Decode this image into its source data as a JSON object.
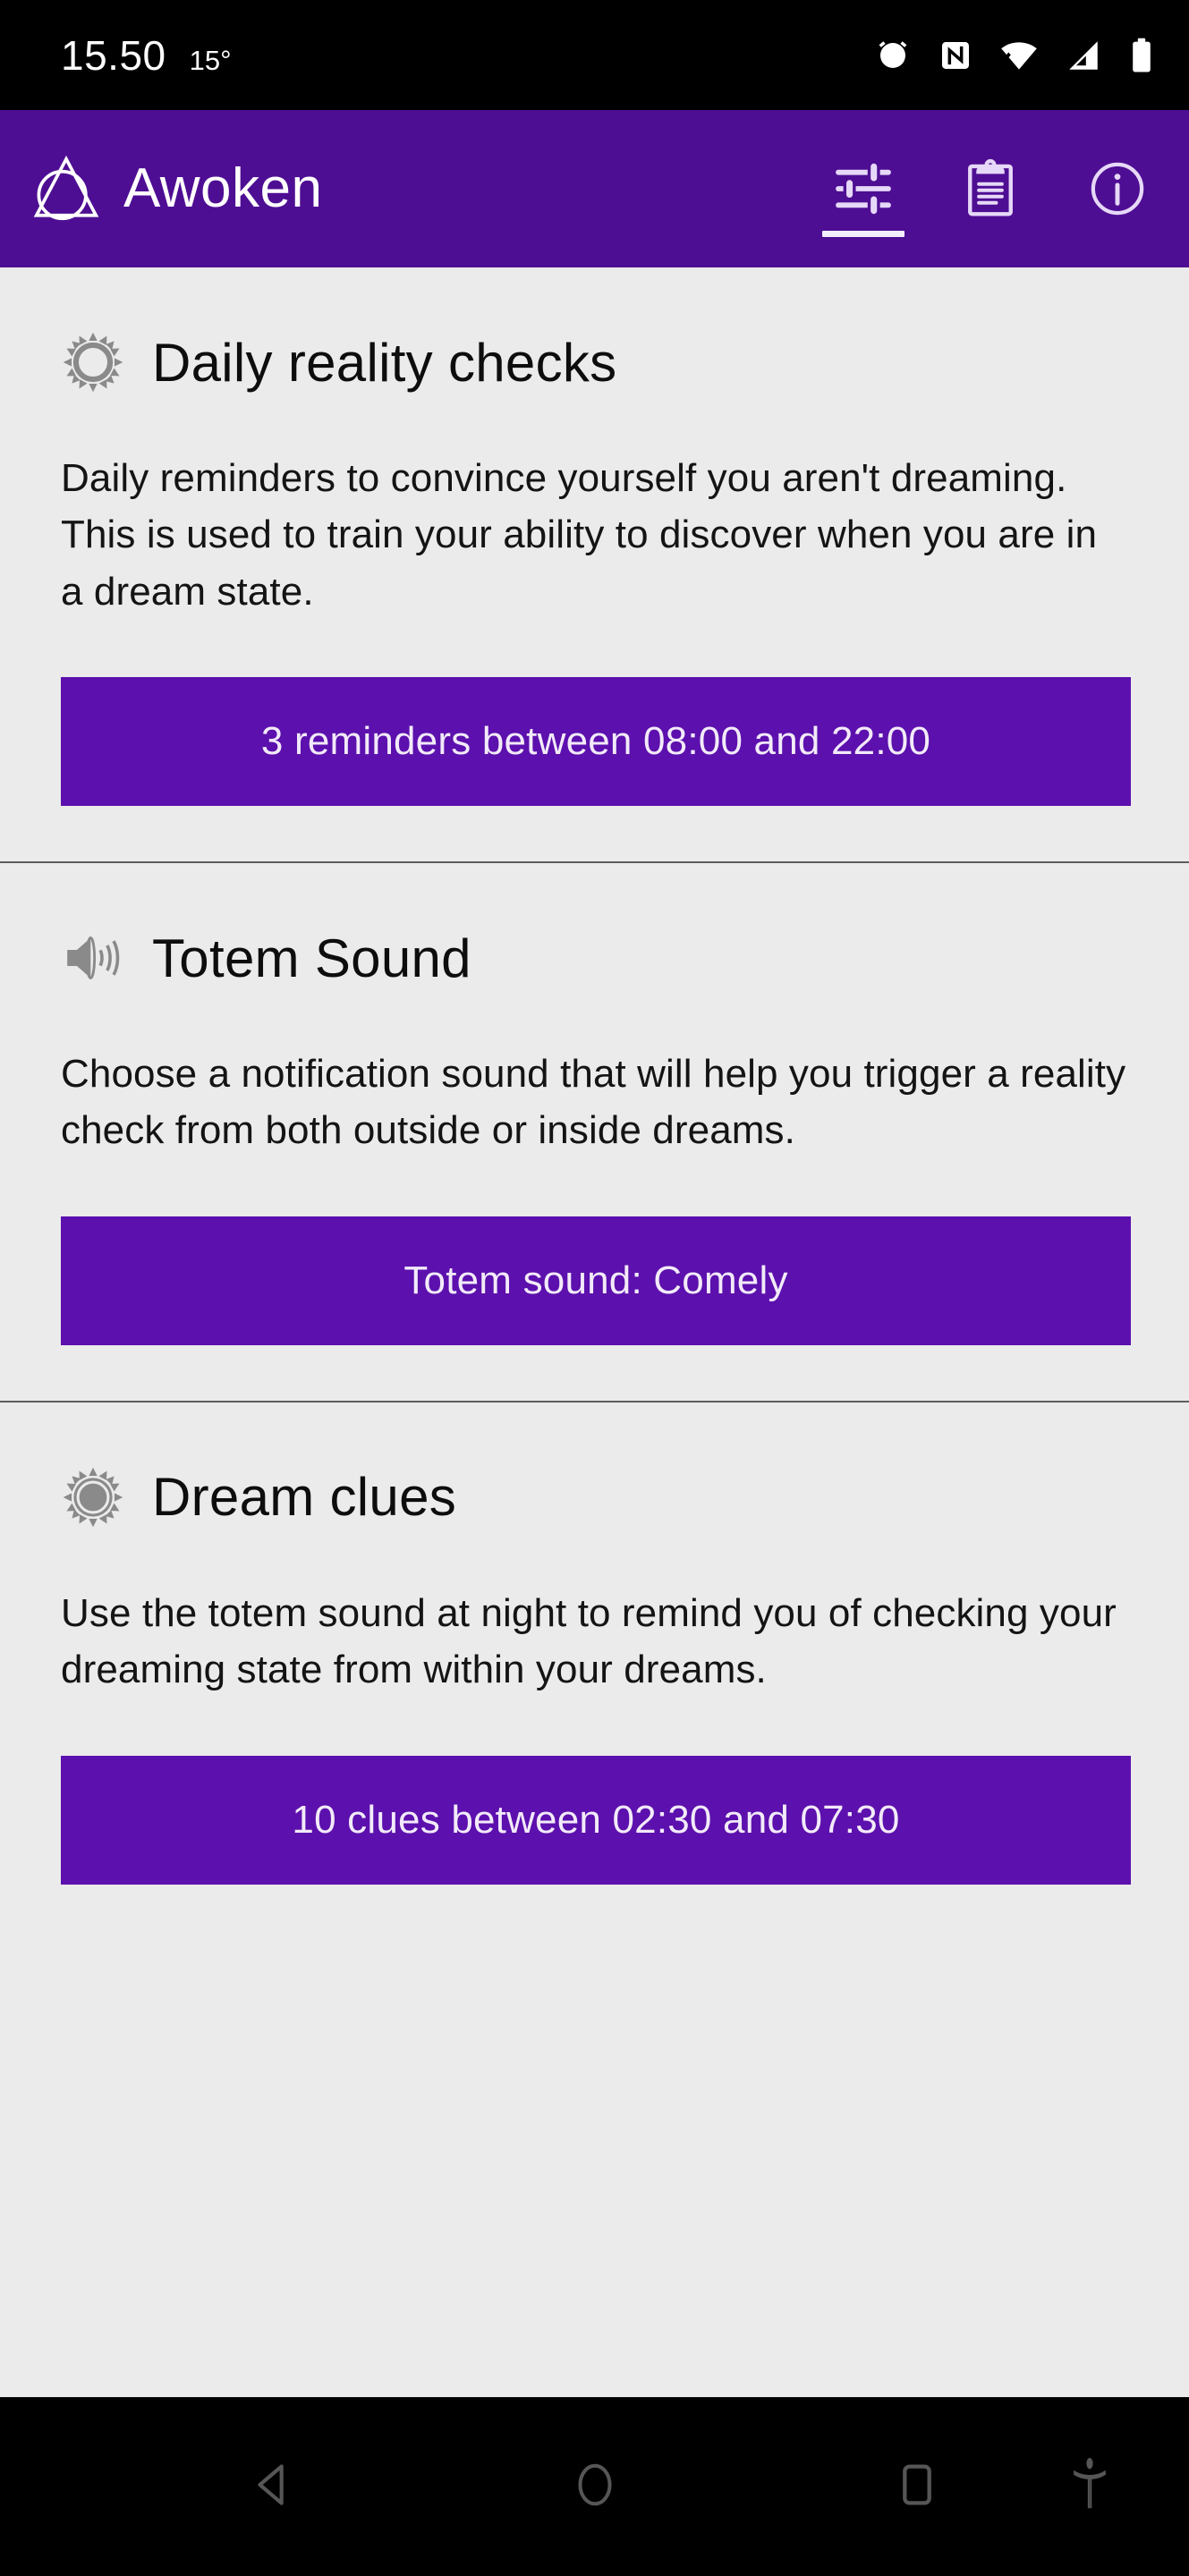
{
  "statusbar": {
    "time": "15.50",
    "temperature": "15°",
    "icons": [
      "alarm-clock-icon",
      "nfc-icon",
      "wifi-icon",
      "cellular-signal-icon",
      "battery-icon"
    ]
  },
  "appbar": {
    "title": "Awoken",
    "logo": "awoken-triangle-circle-logo",
    "background_color": "#4e0e93",
    "tabs": [
      {
        "name": "tab-settings",
        "icon": "sliders-tune-icon",
        "active": true
      },
      {
        "name": "tab-journal",
        "icon": "clipboard-icon",
        "active": false
      },
      {
        "name": "tab-info",
        "icon": "info-circle-icon",
        "active": false
      }
    ]
  },
  "main": {
    "background_color": "#ebebeb",
    "accent_color": "#5c10ad",
    "sections": [
      {
        "icon": "sun-outline-icon",
        "title": "Daily reality checks",
        "description": "Daily reminders to convince yourself you aren't dreaming. This is used to train your ability to discover when you are in a dream state.",
        "button_label": "3 reminders between 08:00 and 22:00"
      },
      {
        "icon": "speaker-volume-icon",
        "title": "Totem Sound",
        "description": "Choose a notification sound that will help you trigger a reality check from both outside or inside dreams.",
        "button_label": "Totem sound: Comely"
      },
      {
        "icon": "sun-filled-icon",
        "title": "Dream clues",
        "description": "Use the totem sound at night to remind you of checking your dreaming state from within your dreams.",
        "button_label": "10 clues between 02:30 and 07:30"
      }
    ]
  },
  "navbar": {
    "buttons": [
      {
        "name": "nav-back-button",
        "icon": "back-triangle-icon"
      },
      {
        "name": "nav-home-button",
        "icon": "home-circle-icon"
      },
      {
        "name": "nav-recents-button",
        "icon": "recents-square-icon"
      }
    ],
    "accessibility": {
      "name": "nav-accessibility-button",
      "icon": "accessibility-person-icon"
    }
  }
}
